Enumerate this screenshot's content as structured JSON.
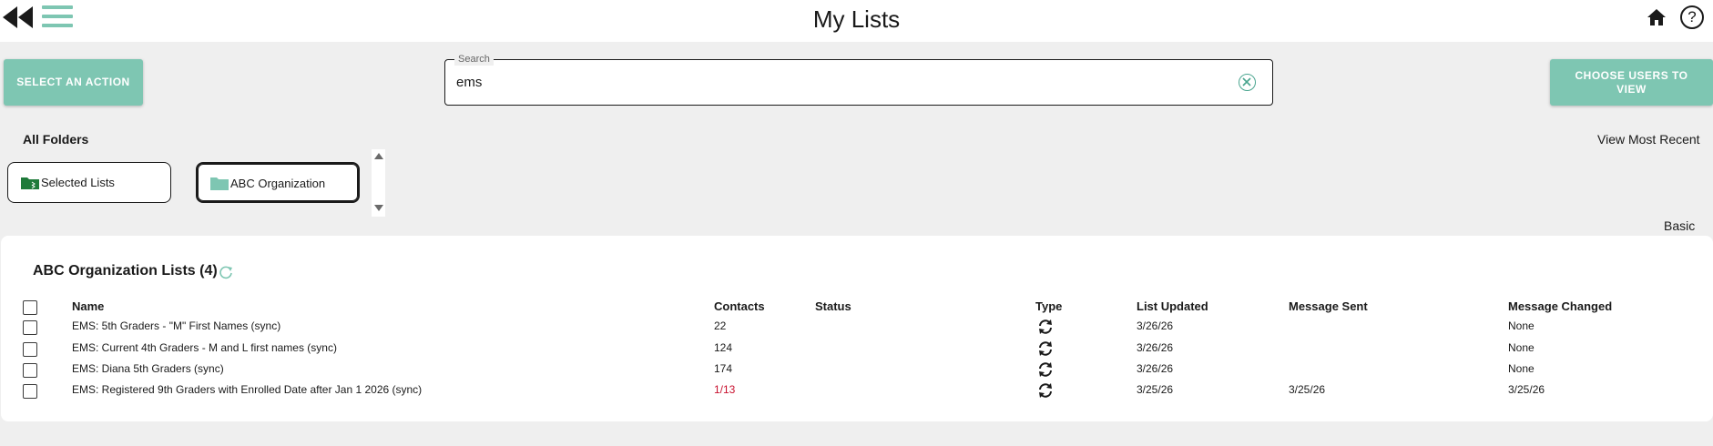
{
  "header": {
    "title": "My Lists",
    "help_label": "?"
  },
  "toolbar": {
    "action_label": "SELECT AN ACTION",
    "choose_users_label": "CHOOSE USERS TO VIEW"
  },
  "search": {
    "legend": "Search",
    "value": "ems",
    "placeholder": ""
  },
  "folders": {
    "all_folders_label": "All Folders",
    "view_most_recent_label": "View Most Recent",
    "items": [
      {
        "label": "Selected Lists",
        "icon": "folder-list-icon",
        "color": "#1f7a3a"
      },
      {
        "label": "ABC Organization",
        "icon": "folder-icon",
        "color": "#7ec6b2"
      }
    ]
  },
  "view_mode_label": "Basic",
  "lists_panel": {
    "title": "ABC Organization Lists (4)",
    "columns": {
      "name": "Name",
      "contacts": "Contacts",
      "status": "Status",
      "type": "Type",
      "list_updated": "List Updated",
      "message_sent": "Message Sent",
      "message_changed": "Message Changed"
    },
    "rows": [
      {
        "name": "EMS: 5th Graders - \"M\" First Names (sync)",
        "contacts": "22",
        "status": "",
        "type": "sync-icon",
        "list_updated": "3/26/26",
        "message_sent": "",
        "message_changed": "None"
      },
      {
        "name": "EMS: Current 4th Graders - M and L first names (sync)",
        "contacts": "124",
        "status": "",
        "type": "sync-icon",
        "list_updated": "3/26/26",
        "message_sent": "",
        "message_changed": "None"
      },
      {
        "name": "EMS: Diana 5th Graders (sync)",
        "contacts": "174",
        "status": "",
        "type": "sync-icon",
        "list_updated": "3/26/26",
        "message_sent": "",
        "message_changed": "None"
      },
      {
        "name": "EMS: Registered 9th Graders with Enrolled Date after Jan 1 2026 (sync)",
        "contacts": "1/13",
        "status": "",
        "type": "sync-icon",
        "list_updated": "3/25/26",
        "message_sent": "3/25/26",
        "message_changed": "3/25/26"
      }
    ]
  },
  "colors": {
    "accent": "#7ec6b2",
    "alert_text": "#c8102e",
    "background": "#efefef"
  }
}
